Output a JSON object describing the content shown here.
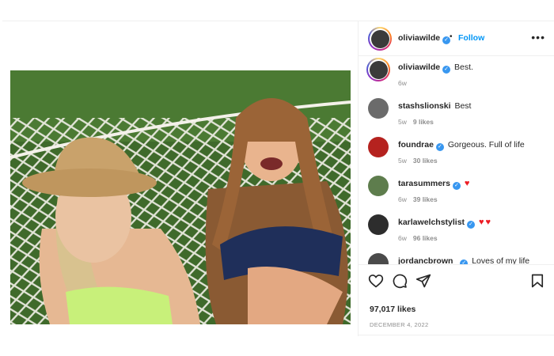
{
  "post": {
    "author": "oliviawilde",
    "follow_label": "Follow",
    "separator": "•",
    "more_label": "•••",
    "likes": "97,017 likes",
    "date": "DECEMBER 4, 2022"
  },
  "comments": [
    {
      "user": "oliviawilde",
      "verified": true,
      "text": "Best.",
      "age": "6w",
      "likes": "",
      "hearts": 0
    },
    {
      "user": "stashslionski",
      "verified": false,
      "text": "Best",
      "age": "5w",
      "likes": "9 likes",
      "hearts": 0
    },
    {
      "user": "foundrae",
      "verified": true,
      "text": "Gorgeous. Full of life",
      "age": "5w",
      "likes": "30 likes",
      "hearts": 0
    },
    {
      "user": "tarasummers",
      "verified": true,
      "text": "",
      "age": "6w",
      "likes": "39 likes",
      "hearts": 1
    },
    {
      "user": "karlawelchstylist",
      "verified": true,
      "text": "",
      "age": "6w",
      "likes": "96 likes",
      "hearts": 2
    },
    {
      "user": "jordancbrown_",
      "verified": true,
      "text": "Loves of my life",
      "age": "",
      "likes": "",
      "hearts": 0
    }
  ],
  "icons": {
    "like": "heart-outline-icon",
    "comment": "comment-bubble-icon",
    "share": "paper-plane-icon",
    "save": "bookmark-icon",
    "verified": "verified-badge-icon",
    "heart_emoji": "red-heart-icon"
  },
  "colors": {
    "link_blue": "#0095f6",
    "verified_blue": "#3897f0",
    "muted_gray": "#8e8e8e",
    "heart_red": "#ed1c24"
  }
}
